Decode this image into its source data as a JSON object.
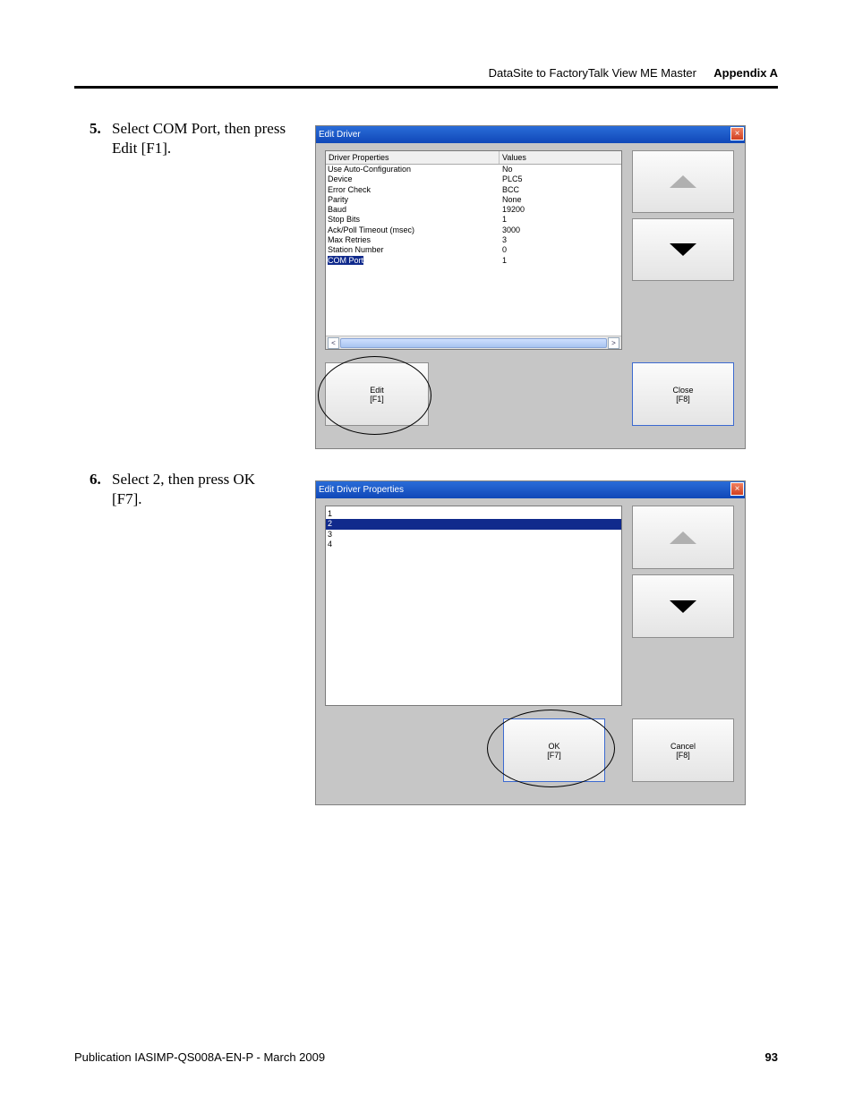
{
  "header": {
    "title": "DataSite to FactoryTalk View ME Master",
    "appendix": "Appendix A"
  },
  "steps": [
    {
      "num": "5.",
      "text": "Select COM Port, then press Edit [F1]."
    },
    {
      "num": "6.",
      "text": "Select 2, then press OK [F7]."
    }
  ],
  "edit_driver": {
    "title": "Edit Driver",
    "close_glyph": "×",
    "columns": [
      "Driver Properties",
      "Values"
    ],
    "rows": [
      {
        "prop": "Use Auto-Configuration",
        "value": "No"
      },
      {
        "prop": "Device",
        "value": "PLC5"
      },
      {
        "prop": "Error Check",
        "value": "BCC"
      },
      {
        "prop": "Parity",
        "value": "None"
      },
      {
        "prop": "Baud",
        "value": "19200"
      },
      {
        "prop": "Stop Bits",
        "value": "1"
      },
      {
        "prop": "Ack/Poll Timeout (msec)",
        "value": "3000"
      },
      {
        "prop": "Max Retries",
        "value": "3"
      },
      {
        "prop": "Station Number",
        "value": "0"
      },
      {
        "prop": "COM Port",
        "value": "1"
      }
    ],
    "selected_row": 9,
    "scroll_left": "<",
    "scroll_right": ">",
    "edit_label": "Edit",
    "edit_key": "[F1]",
    "close_label": "Close",
    "close_key": "[F8]"
  },
  "edit_props": {
    "title": "Edit Driver Properties",
    "close_glyph": "×",
    "options": [
      "1",
      "2",
      "3",
      "4"
    ],
    "selected_option": 1,
    "ok_label": "OK",
    "ok_key": "[F7]",
    "cancel_label": "Cancel",
    "cancel_key": "[F8]"
  },
  "footer": {
    "publication": "Publication IASIMP-QS008A-EN-P - March 2009",
    "page": "93"
  }
}
